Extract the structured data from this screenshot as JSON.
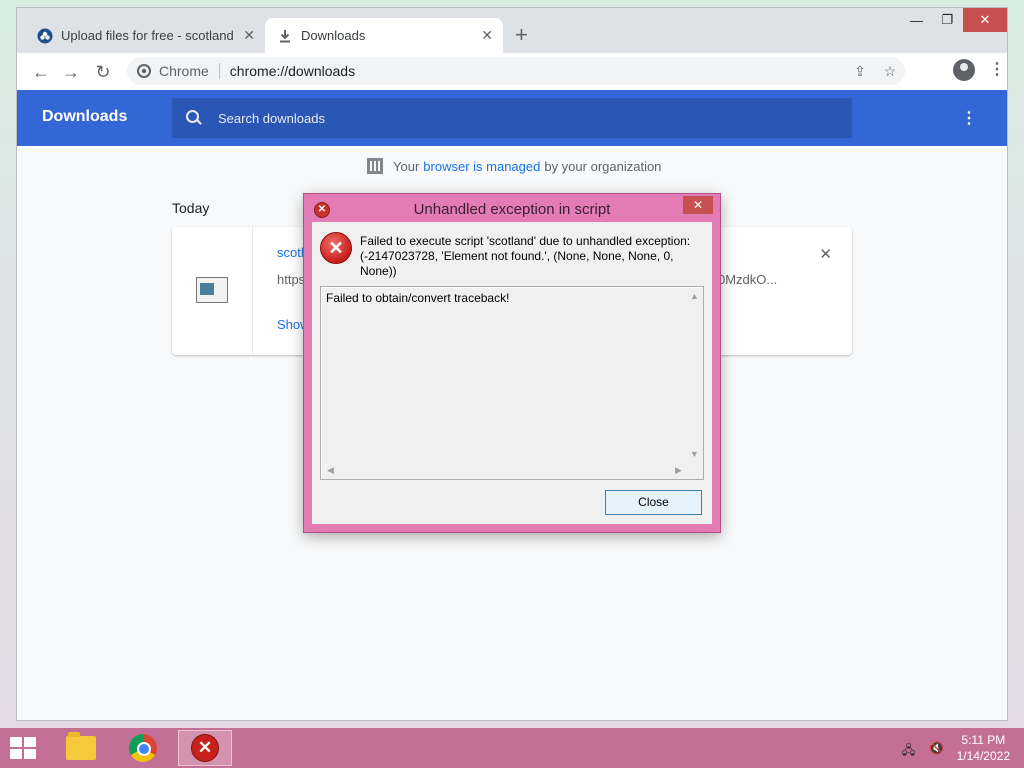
{
  "browser": {
    "tabs": [
      {
        "label": "Upload files for free - scotland_fu",
        "icon": "upload-site-icon"
      },
      {
        "label": "Downloads",
        "icon": "download-icon"
      }
    ],
    "omnibox": {
      "site": "Chrome",
      "url": "chrome://downloads"
    }
  },
  "downloads_page": {
    "title": "Downloads",
    "search_placeholder": "Search downloads",
    "managed_prefix": "Your",
    "managed_link": "browser is managed",
    "managed_suffix": "by your organization",
    "section": "Today",
    "item": {
      "filename": "scotl",
      "url_start": "https",
      "url_end": "0MzdkO...",
      "action": "Show"
    }
  },
  "dialog": {
    "title": "Unhandled exception in script",
    "message": "Failed to execute script 'scotland' due to unhandled exception: (-2147023728, 'Element not found.', (None, None, None, 0, None))",
    "traceback": "Failed to obtain/convert traceback!",
    "close_label": "Close"
  },
  "taskbar": {
    "time": "5:11 PM",
    "date": "1/14/2022"
  },
  "colors": {
    "header_blue": "#3367d6",
    "dialog_frame": "#e37cb5",
    "taskbar": "#c46f96"
  }
}
